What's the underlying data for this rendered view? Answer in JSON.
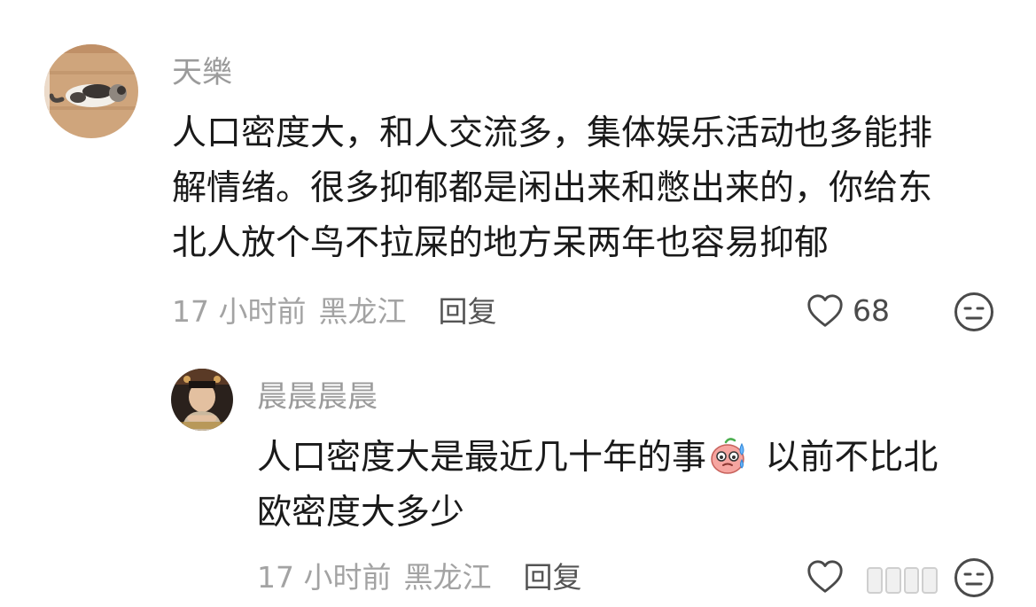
{
  "colors": {
    "username": "#9b9b9b",
    "text": "#1a1a1a",
    "meta": "#a3a3a3",
    "reply": "#545454",
    "icon": "#4a4a4a"
  },
  "comments": [
    {
      "username": "天樂",
      "avatar_icon": "cat-avatar",
      "content_lines": [
        "人口密度大，和人交流多，集体娱乐活动也多能排",
        "解情绪。很多抑郁都是闲出来和憋出来的，你给东",
        "北人放个鸟不拉屎的地方呆两年也容易抑郁"
      ],
      "time": "17 小时前",
      "location": "黑龙江",
      "reply_label": "回复",
      "like_icon": "heart-outline-icon",
      "like_count": "68",
      "reaction_icon": "meh-face-icon"
    },
    {
      "username": "晨晨晨晨",
      "avatar_icon": "man-avatar",
      "content_before_emoji": "人口密度大是最近几十年的事",
      "emoji_icon": "sweat-face-emoji",
      "content_after_emoji": " 以前不比北",
      "content_line2": "欧密度大多少",
      "time": "17 小时前",
      "location": "黑龙江",
      "reply_label": "回复",
      "like_icon": "heart-outline-icon",
      "reaction_icon": "meh-face-icon"
    }
  ]
}
